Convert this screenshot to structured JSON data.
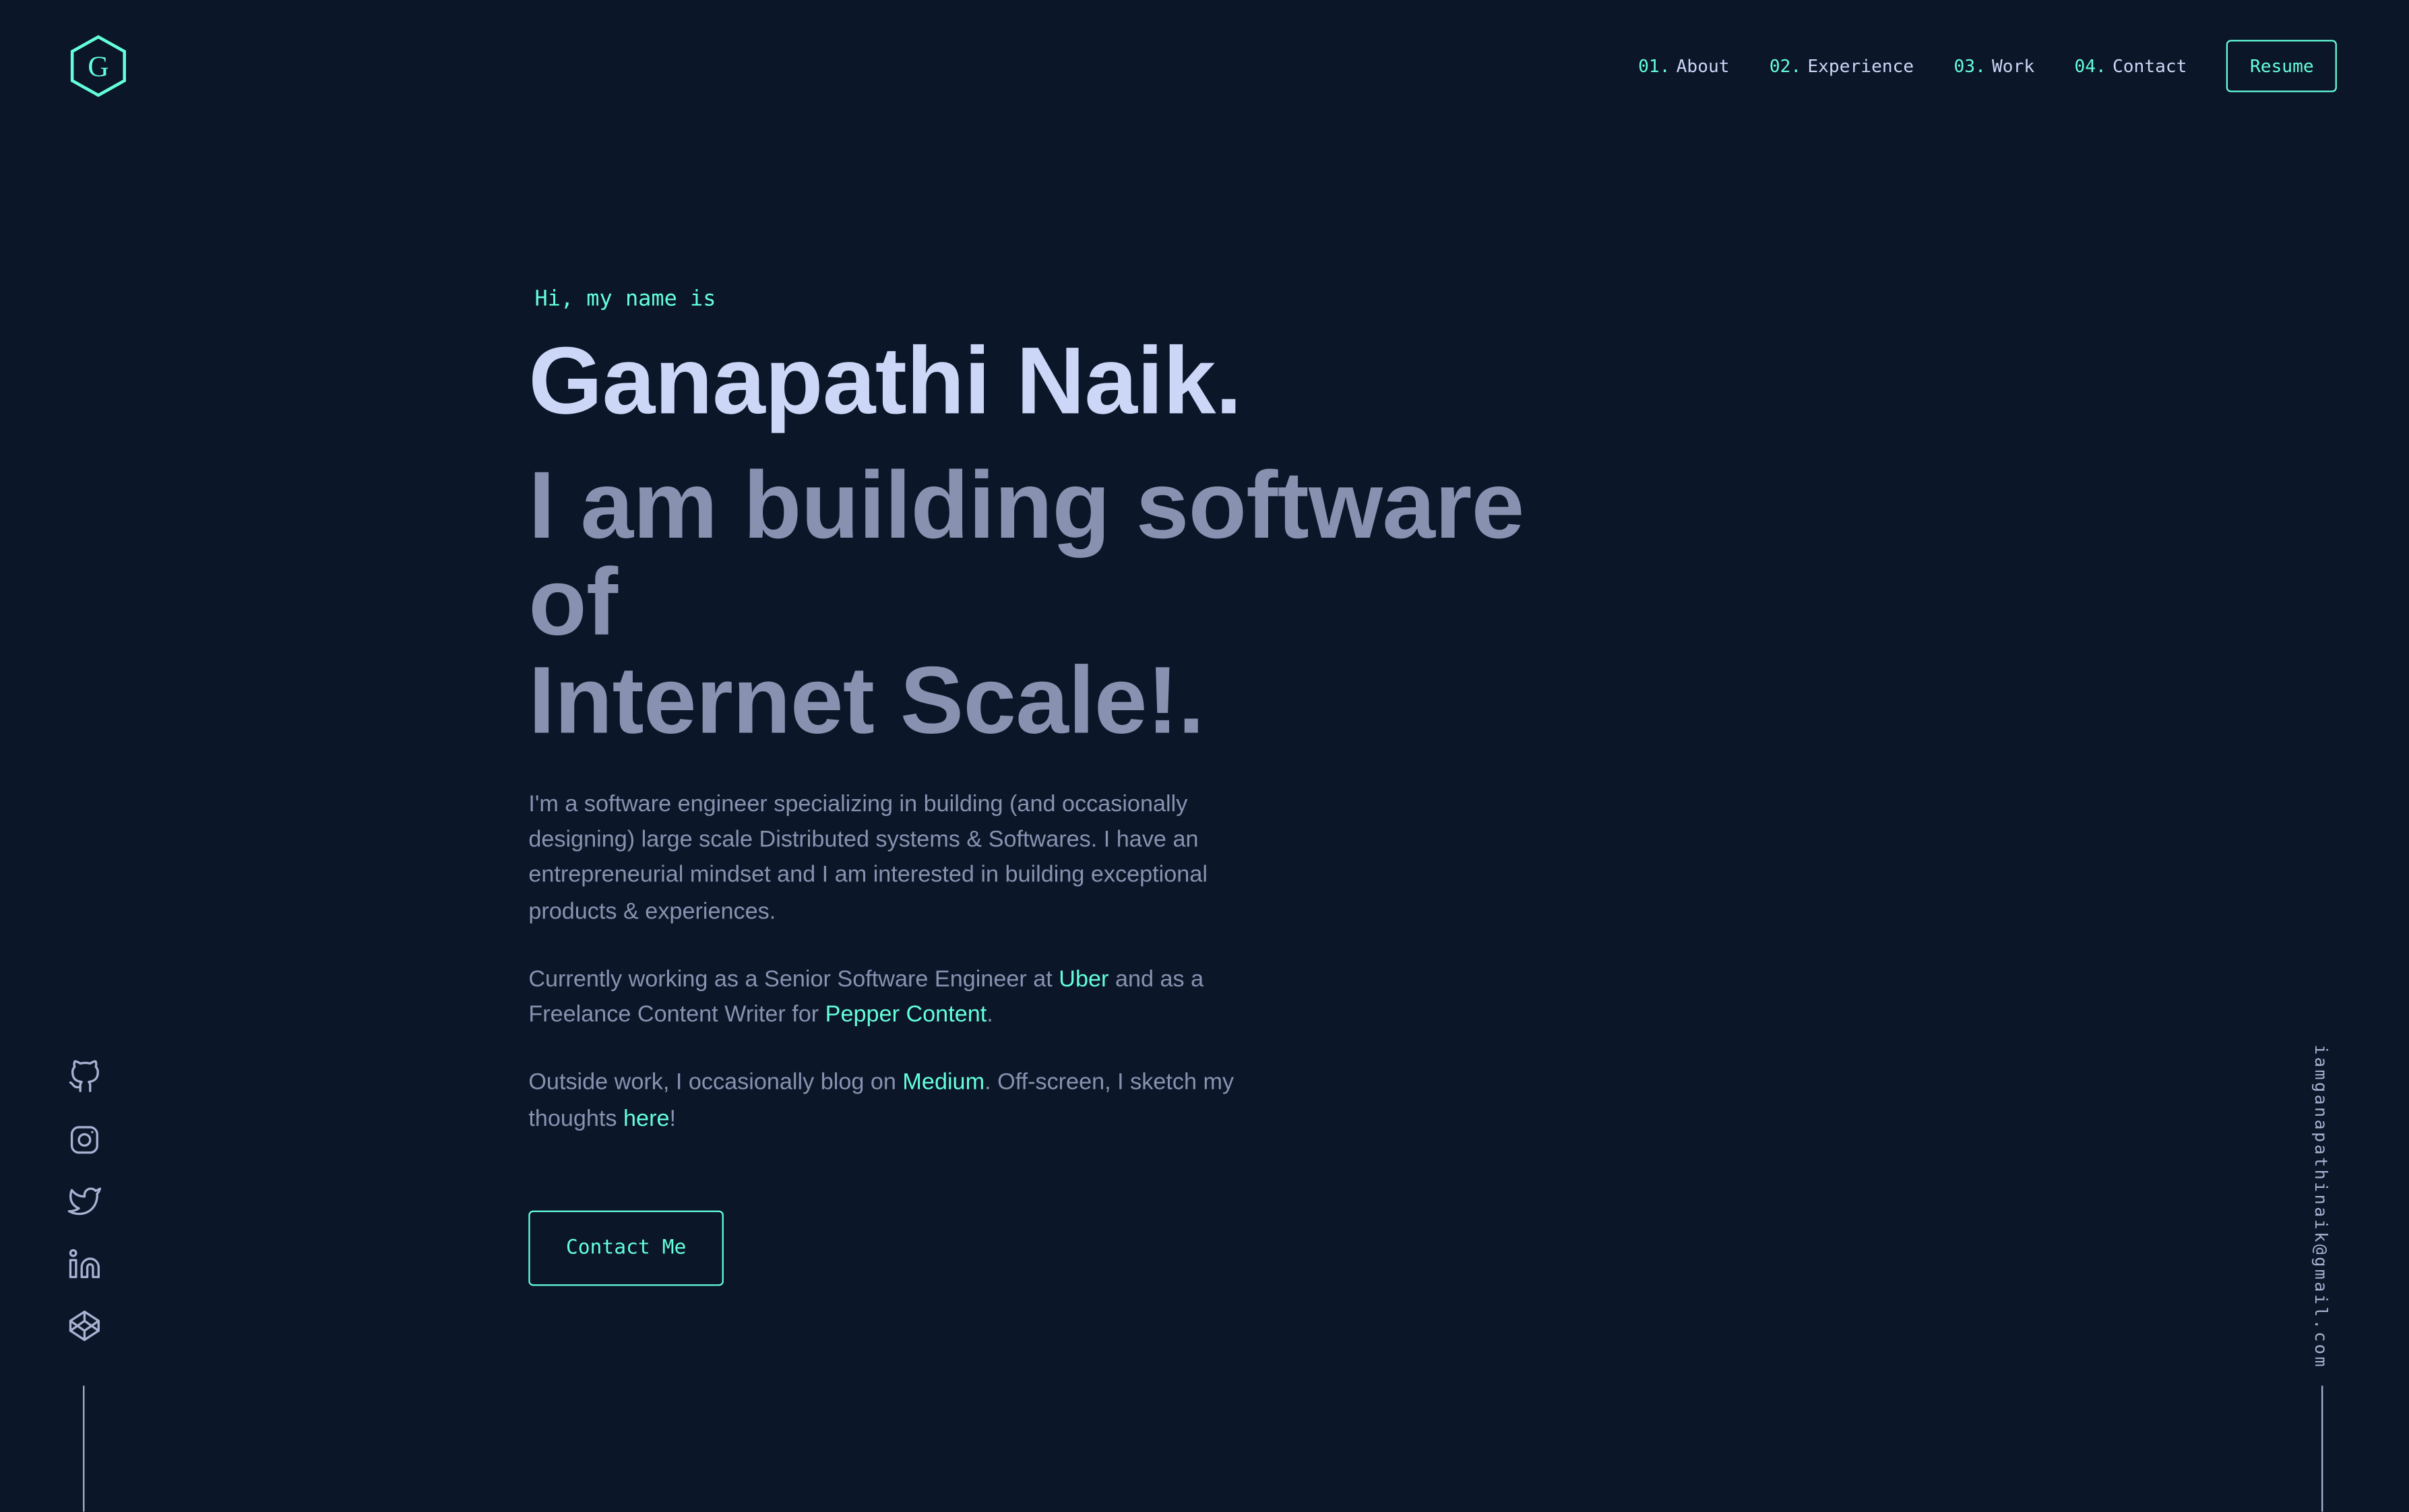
{
  "colors": {
    "background": "#0b1629",
    "accent": "#64ffda",
    "heading": "#ccd6f6",
    "body": "#8892b0"
  },
  "logo": {
    "letter": "G",
    "icon": "hexagon-logo-icon"
  },
  "nav": {
    "items": [
      {
        "num": "01.",
        "label": "About"
      },
      {
        "num": "02.",
        "label": "Experience"
      },
      {
        "num": "03.",
        "label": "Work"
      },
      {
        "num": "04.",
        "label": "Contact"
      }
    ],
    "resume_label": "Resume"
  },
  "hero": {
    "intro": "Hi, my name is",
    "name": "Ganapathi Naik.",
    "tagline_line1": "I am building software of",
    "tagline_line2": "Internet Scale!.",
    "para1": "I'm a software engineer specializing in building (and occasionally designing) large scale Distributed systems & Softwares. I have an entrepreneurial mindset and I am interested in building exceptional products & experiences.",
    "para2_part1": "Currently working as a Senior Software Engineer at ",
    "para2_link1": "Uber",
    "para2_part2": " and as a Freelance Content Writer for ",
    "para2_link2": "Pepper Content",
    "para2_part3": ".",
    "para3_part1": "Outside work, I occasionally blog on ",
    "para3_link1": "Medium",
    "para3_part2": ". Off-screen, I sketch my thoughts ",
    "para3_link2": "here",
    "para3_part3": "!",
    "contact_label": "Contact Me"
  },
  "socials": [
    "github-icon",
    "instagram-icon",
    "twitter-icon",
    "linkedin-icon",
    "codepen-icon"
  ],
  "email": "iamganapathinaik@gmail.com"
}
